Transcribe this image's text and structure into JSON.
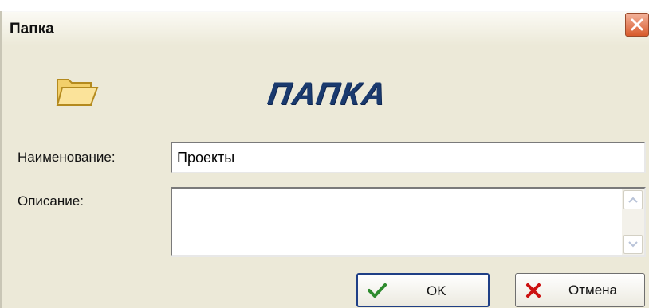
{
  "window": {
    "title": "Папка",
    "close_icon": "close-icon"
  },
  "header": {
    "folder_icon": "folder-icon",
    "banner": "ПАПКА"
  },
  "form": {
    "name_label": "Наименование:",
    "name_value": "Проекты",
    "description_label": "Описание:",
    "description_value": ""
  },
  "buttons": {
    "ok_label": "OK",
    "cancel_label": "Отмена"
  },
  "colors": {
    "window_bg": "#ece9d8",
    "banner": "#1a3a6e",
    "close_button": "#d85a2c",
    "ok_check": "#2e8b2e",
    "cancel_x": "#cc1111"
  }
}
